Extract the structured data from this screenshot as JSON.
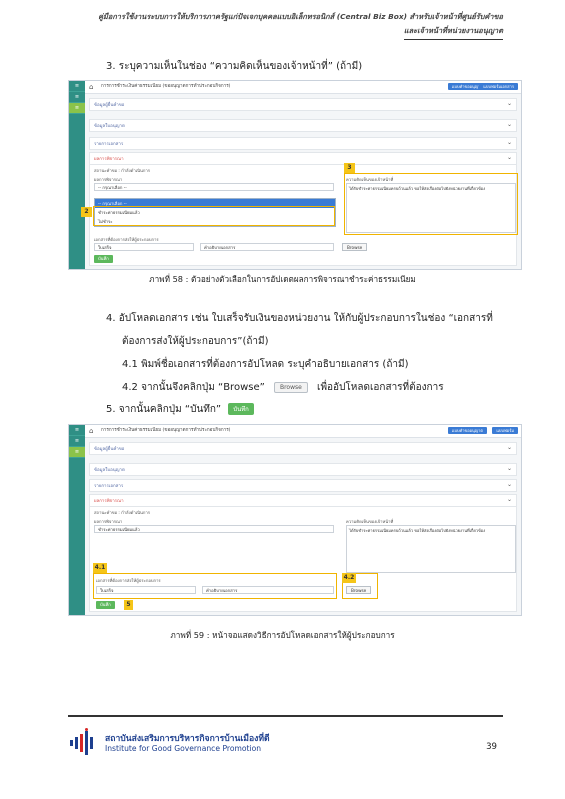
{
  "header": {
    "line1": "คู่มือการใช้งานระบบการให้บริการภาครัฐแก่ปัจเจกบุคคลแบบอิเล็กทรอนิกส์ (Central Biz Box) สำหรับเจ้าหน้าที่ศูนย์รับคำขอ",
    "line2": "และเจ้าหน้าที่หน่วยงานอนุญาต"
  },
  "step3": "3.  ระบุความเห็นในช่อง “ความคิดเห็นของเจ้าหน้าที่” (ถ้ามี)",
  "shot1": {
    "title": "การการชำระเงินค่าธรรมเนียม (ขออนุญาตการทำประกอบกิจการ)",
    "tb1": "แบบคำขออนุญาต",
    "tb2": "แบบฟอร์มเอกสาร",
    "sec1": "ข้อมูลผู้ยื่นคำขอ",
    "sec2": "ข้อมูลใบอนุญาต",
    "sec3": "รายการเอกสาร",
    "sec4": "ผลการพิจารณา",
    "status_label": "สถานะคำขอ : กำลังดำเนินการ",
    "select_label": "ผลการพิจารณา",
    "select_value": "-- กรุณาเลือก --",
    "options": [
      "-- กรุณาเลือก --",
      "ชำระค่าธรรมเนียมแล้ว",
      "ไม่ชำระ"
    ],
    "comment_label": "ความคิดเห็นของเจ้าหน้าที่",
    "comment_text": "ได้รับชำระค่าธรรมเนียมครบถ้วนแล้ว ขอให้ส่งเรื่องต่อไปยังหน่วยงานที่เกี่ยวข้อง",
    "doc_label": "เอกสารที่ต้องการส่งให้ผู้ประกอบการ",
    "doc_name": "ใบเสร็จ",
    "doc_desc": "คำอธิบายเอกสาร",
    "browse": "Browse",
    "save": "บันทึก",
    "marker2": "2",
    "marker3": "3"
  },
  "caption1": "ภาพที่ 58 : ตัวอย่างตัวเลือกในการอัปเดตผลการพิจารณาชำระค่าธรรมเนียม",
  "step4_line1": "4.  อัปโหลดเอกสาร เช่น ใบเสร็จรับเงินของหน่วยงาน ให้กับผู้ประกอบการในช่อง “เอกสารที่",
  "step4_line2": "ต้องการส่งให้ผู้ประกอบการ”(ถ้ามี)",
  "step41": "4.1  พิมพ์ชื่อเอกสารที่ต้องการอัปโหลด ระบุคำอธิบายเอกสาร (ถ้ามี)",
  "step42_pre": "4.2  จากนั้นจึงคลิกปุ่ม “Browse”",
  "step42_btn": "Browse",
  "step42_post": "เพื่ออัปโหลดเอกสารที่ต้องการ",
  "step5_pre": "5.  จากนั้นคลิกปุ่ม “บันทึก”",
  "step5_btn": "บันทึก",
  "shot2": {
    "title": "การการชำระเงินค่าธรรมเนียม (ขออนุญาตการทำประกอบกิจการ)",
    "tb1": "แบบคำขออนุญาต",
    "tb2": "แบบฟอร์ม",
    "sec1": "ข้อมูลผู้ยื่นคำขอ",
    "sec2": "ข้อมูลใบอนุญาต",
    "sec3": "รายการเอกสาร",
    "sec4": "ผลการพิจารณา",
    "status_label": "สถานะคำขอ : กำลังดำเนินการ",
    "select_label": "ผลการพิจารณา",
    "select_value": "ชำระค่าธรรมเนียมแล้ว",
    "comment_label": "ความคิดเห็นของเจ้าหน้าที่",
    "comment_text": "ได้รับชำระค่าธรรมเนียมครบถ้วนแล้ว ขอให้ส่งเรื่องต่อไปยังหน่วยงานที่เกี่ยวข้อง",
    "doc_label": "เอกสารที่ต้องการส่งให้ผู้ประกอบการ",
    "doc_name": "ใบเสร็จ",
    "doc_desc": "คำอธิบายเอกสาร",
    "browse": "Browse",
    "save": "บันทึก",
    "marker41": "4.1",
    "marker42": "4.2",
    "marker5": "5"
  },
  "caption2": "ภาพที่ 59 : หน้าจอแสดงวิธีการอัปโหลดเอกสารให้ผู้ประกอบการ",
  "footer": {
    "org_th": "สถาบันส่งเสริมการบริหารกิจการบ้านเมืองที่ดี",
    "org_en": "Institute for Good Governance Promotion",
    "page": "39"
  }
}
